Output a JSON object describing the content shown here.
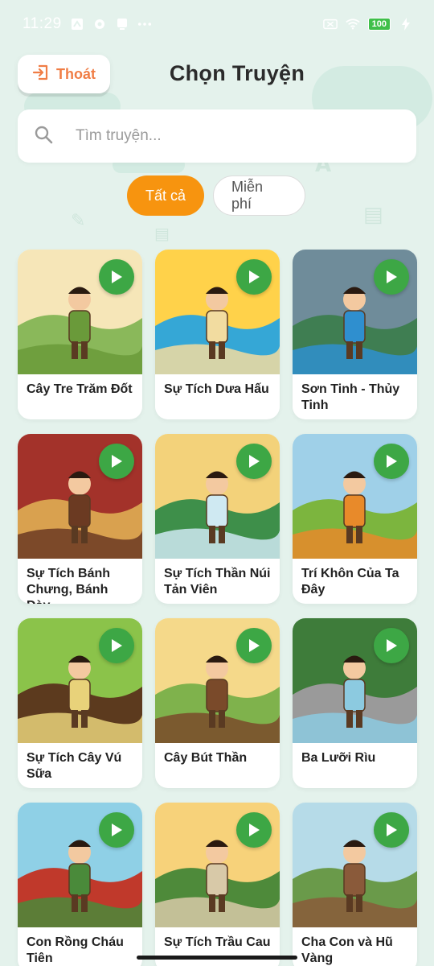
{
  "status_bar": {
    "time": "11:29",
    "battery": "100",
    "icons": [
      "cast-icon",
      "notification-icon",
      "download-icon",
      "more-icon",
      "sim-icon",
      "wifi-icon",
      "battery-icon",
      "charging-icon"
    ]
  },
  "header": {
    "exit_label": "Thoát",
    "title": "Chọn Truyện"
  },
  "search": {
    "placeholder": "Tìm truyện...",
    "value": ""
  },
  "filters": [
    {
      "label": "Tất cả",
      "active": true
    },
    {
      "label": "Miễn phí",
      "active": false
    }
  ],
  "colors": {
    "background": "#e4f2ec",
    "accent": "#f7940f",
    "exit": "#f07d45",
    "play": "#3da745"
  },
  "stories": [
    {
      "title": "Cây Tre Trăm Đốt",
      "palette": [
        "#f6e6b8",
        "#8ab85a",
        "#6a9a3a"
      ]
    },
    {
      "title": "Sự Tích Dưa Hấu",
      "palette": [
        "#ffd24a",
        "#35a7d6",
        "#f2dca0"
      ]
    },
    {
      "title": "Sơn Tinh - Thủy Tinh",
      "palette": [
        "#6f8c9a",
        "#3f7e52",
        "#2f8fcf"
      ]
    },
    {
      "title": "Sự Tích Bánh Chưng, Bánh Dày",
      "palette": [
        "#a3322a",
        "#d9a14f",
        "#6b3a22"
      ]
    },
    {
      "title": "Sự Tích Thần Núi Tản Viên",
      "palette": [
        "#f3d27a",
        "#3e8f4a",
        "#cfe9f2"
      ]
    },
    {
      "title": "Trí Khôn Của Ta Đây",
      "palette": [
        "#9fd0e8",
        "#7cb53e",
        "#e88a2a"
      ]
    },
    {
      "title": "Sự Tích Cây Vú Sữa",
      "palette": [
        "#8bc34a",
        "#5c3a1e",
        "#e8d27a"
      ]
    },
    {
      "title": "Cây Bút Thần",
      "palette": [
        "#f5d98a",
        "#7fb24c",
        "#7a4a2a"
      ]
    },
    {
      "title": "Ba Lưỡi Rìu",
      "palette": [
        "#3e7c3a",
        "#9a9a9a",
        "#8ccae0"
      ]
    },
    {
      "title": "Con Rồng Cháu Tiên",
      "palette": [
        "#8fd0e6",
        "#c0392b",
        "#4a8a3a"
      ]
    },
    {
      "title": "Sự Tích Trầu Cau",
      "palette": [
        "#f7d27a",
        "#4e8a3a",
        "#d8c9a8"
      ]
    },
    {
      "title": "Cha Con và Hũ Vàng",
      "palette": [
        "#b6dbe8",
        "#6a9a4a",
        "#8a5a3a"
      ]
    }
  ]
}
